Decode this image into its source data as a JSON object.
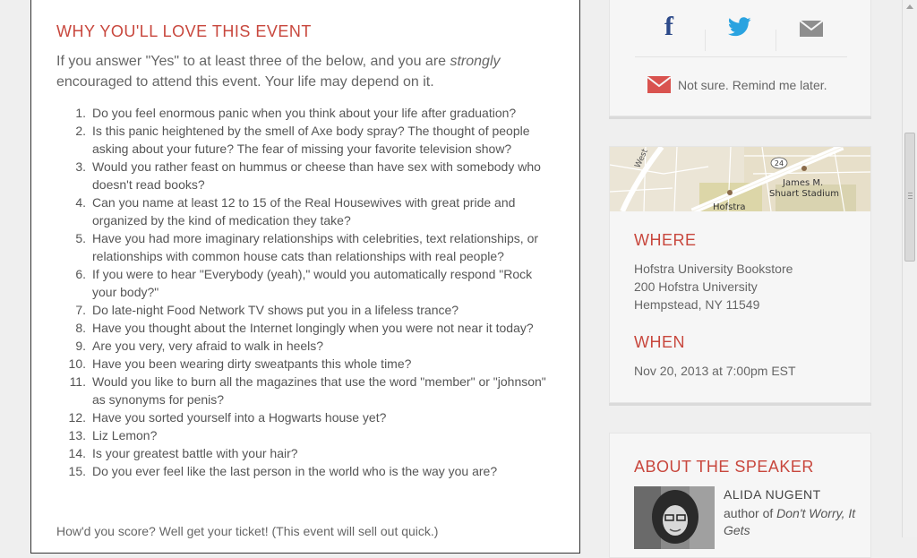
{
  "main": {
    "heading": "WHY YOU'LL LOVE THIS EVENT",
    "intro_before": "If you answer \"Yes\" to at least three of the below, and you are ",
    "intro_emphasis": "strongly",
    "intro_after": " encouraged to attend this event. Your life may depend on it.",
    "questions": [
      {
        "num": "1.",
        "text": "Do you feel enormous panic when you think about your life after graduation?"
      },
      {
        "num": "2.",
        "text": "Is this panic heightened by the smell of Axe body spray? The thought of people asking about your future? The fear of missing your favorite television show?"
      },
      {
        "num": "3.",
        "text": "Would you rather feast on hummus or cheese than have sex with somebody who doesn't read books?"
      },
      {
        "num": "4.",
        "text": "Can you name at least 12 to 15 of the Real Housewives with great pride and organized by the kind of medication they take?"
      },
      {
        "num": "5.",
        "text": "Have you had more imaginary relationships with celebrities, text relationships, or relationships with common house cats than relationships with real people?"
      },
      {
        "num": "6.",
        "text": "If you were to hear \"Everybody (yeah),\" would you automatically respond \"Rock your body?\""
      },
      {
        "num": "7.",
        "text": "Do late-night Food Network TV shows put you in a lifeless trance?"
      },
      {
        "num": "8.",
        "text": "Have you thought about the Internet longingly when you were not near it today?"
      },
      {
        "num": "9.",
        "text": "Are you very, very afraid to walk in heels?"
      },
      {
        "num": "10.",
        "text": "Have you been wearing dirty sweatpants this whole time?"
      },
      {
        "num": "11.",
        "text": "Would you like to burn all the magazines that use the word \"member\" or \"johnson\" as synonyms for penis?"
      },
      {
        "num": "12.",
        "text": "Have you sorted yourself into a Hogwarts house yet?"
      },
      {
        "num": "13.",
        "text": "Liz Lemon?"
      },
      {
        "num": "14.",
        "text": "Is your greatest battle with your hair?"
      },
      {
        "num": "15.",
        "text": "Do you ever feel like the last person in the world who is the way you are?"
      }
    ],
    "outro": "How'd you score? Well get your ticket! (This event will sell out quick.)"
  },
  "share": {
    "facebook_glyph": "f",
    "facebook_icon": "facebook-icon",
    "twitter_icon": "twitter-icon",
    "email_icon": "email-icon",
    "remind_icon": "email-icon",
    "remind_text": "Not sure. Remind me later."
  },
  "map": {
    "road_label": "West",
    "route_label": "24",
    "stadium_label_1": "James M.",
    "stadium_label_2": "Shuart Stadium",
    "place_label": "Hofstra"
  },
  "where": {
    "heading": "WHERE",
    "line1": "Hofstra University Bookstore",
    "line2": "200 Hofstra University",
    "line3": "Hempstead, NY 11549"
  },
  "when": {
    "heading": "WHEN",
    "datetime": "Nov 20, 2013 at 7:00pm EST"
  },
  "speaker": {
    "heading": "ABOUT THE SPEAKER",
    "name": "ALIDA NUGENT",
    "desc_prefix": "author of ",
    "book_title": "Don't Worry, It Gets"
  },
  "colors": {
    "accent": "#c8473d",
    "facebook": "#2d4a8a",
    "twitter": "#2aa3e0",
    "email": "#8e8e8e"
  }
}
